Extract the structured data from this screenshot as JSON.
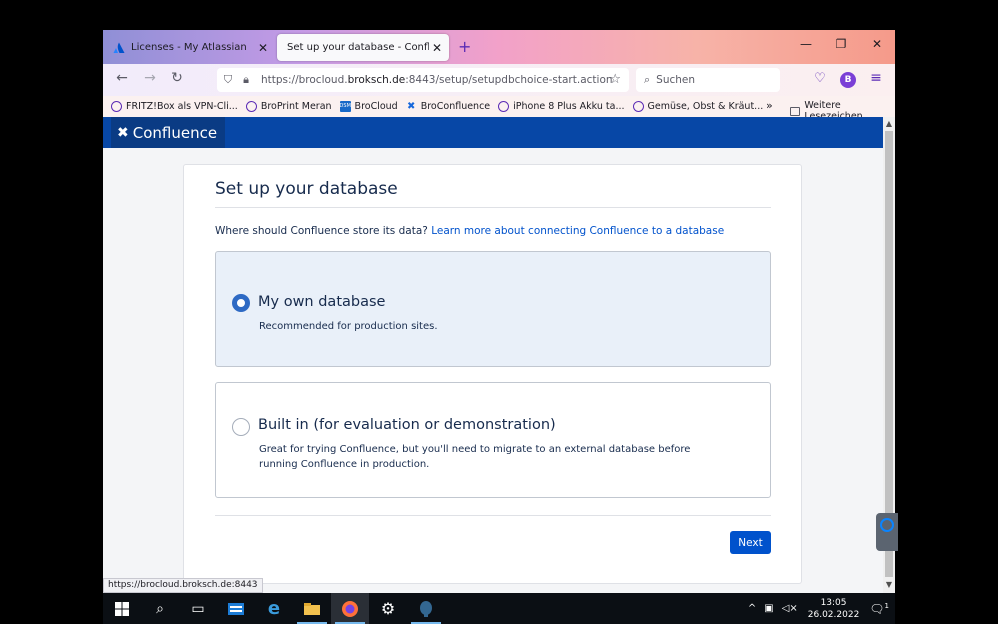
{
  "browser": {
    "tabs": [
      {
        "title": "Licenses - My Atlassian",
        "active": false
      },
      {
        "title": "Set up your database - Confluence",
        "active": true
      }
    ],
    "new_tab_symbol": "+",
    "url": {
      "prefix": "https://brocloud.",
      "host": "broksch.de",
      "suffix": ":8443/setup/setupdbchoice-start.action"
    },
    "search_placeholder": "Suchen",
    "avatar_letter": "B",
    "bookmarks": [
      {
        "label": "FRITZ!Box als VPN-Cli...",
        "icon": "globe-icon"
      },
      {
        "label": "BroPrint Meran",
        "icon": "globe-icon"
      },
      {
        "label": "BroCloud",
        "icon": "dsm-icon"
      },
      {
        "label": "BroConfluence",
        "icon": "confluence-icon"
      },
      {
        "label": "iPhone 8 Plus Akku ta...",
        "icon": "globe-icon"
      },
      {
        "label": "Gemüse, Obst & Kräut...",
        "icon": "globe-icon"
      }
    ],
    "bookmarks_more": "»",
    "other_bookmarks": "Weitere Lesezeichen",
    "status_url": "https://brocloud.broksch.de:8443"
  },
  "confluence": {
    "logo_text": "Confluence",
    "panel_title": "Set up your database",
    "question": "Where should Confluence store its data?",
    "learn_more": "Learn more about connecting Confluence to a database",
    "options": [
      {
        "label": "My own database",
        "description": "Recommended for production sites.",
        "selected": true
      },
      {
        "label": "Built in (for evaluation or demonstration)",
        "description": "Great for trying Confluence, but you'll need to migrate to an external database before running Confluence in production.",
        "selected": false
      }
    ],
    "next_label": "Next"
  },
  "taskbar": {
    "time": "13:05",
    "date": "26.02.2022",
    "notification_count": "1"
  },
  "colors": {
    "confluence_header": "#0747a6",
    "primary_button": "#0052cc",
    "selected_option_bg": "#e9f0f9",
    "link": "#0052cc"
  }
}
